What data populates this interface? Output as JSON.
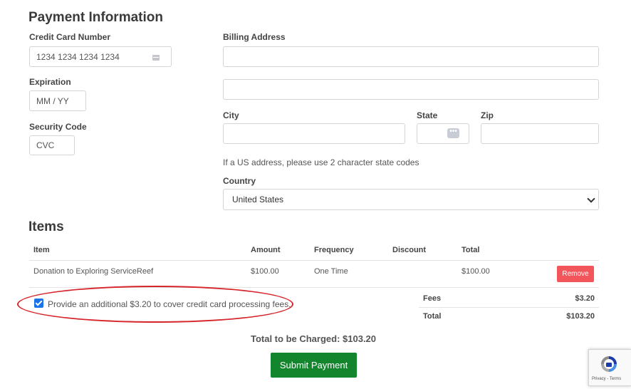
{
  "payment": {
    "title": "Payment Information",
    "card_number_label": "Credit Card Number",
    "card_number_placeholder": "1234 1234 1234 1234",
    "expiration_label": "Expiration",
    "expiration_placeholder": "MM / YY",
    "security_label": "Security Code",
    "security_placeholder": "CVC",
    "billing_label": "Billing Address",
    "city_label": "City",
    "state_label": "State",
    "zip_label": "Zip",
    "state_hint": "If a US address, please use 2 character state codes",
    "country_label": "Country",
    "country_value": "United States"
  },
  "items": {
    "title": "Items",
    "columns": [
      "Item",
      "Amount",
      "Frequency",
      "Discount",
      "Total"
    ],
    "rows": [
      {
        "item": "Donation to Exploring ServiceReef",
        "amount": "$100.00",
        "frequency": "One Time",
        "discount": "",
        "total": "$100.00",
        "remove_label": "Remove"
      }
    ],
    "fee_checkbox_label": "Provide an additional $3.20 to cover credit card processing fees.",
    "fee_checked": true,
    "fees_label": "Fees",
    "fees_value": "$3.20",
    "total_label": "Total",
    "total_value": "$103.20"
  },
  "footer": {
    "total_charged": "Total to be Charged: $103.20",
    "submit_label": "Submit Payment",
    "recaptcha_text": "Privacy - Terms"
  },
  "colors": {
    "submit": "#12852d",
    "remove": "#f2565a",
    "checkbox": "#1a73e8",
    "annotation_oval": "#d6252a"
  }
}
